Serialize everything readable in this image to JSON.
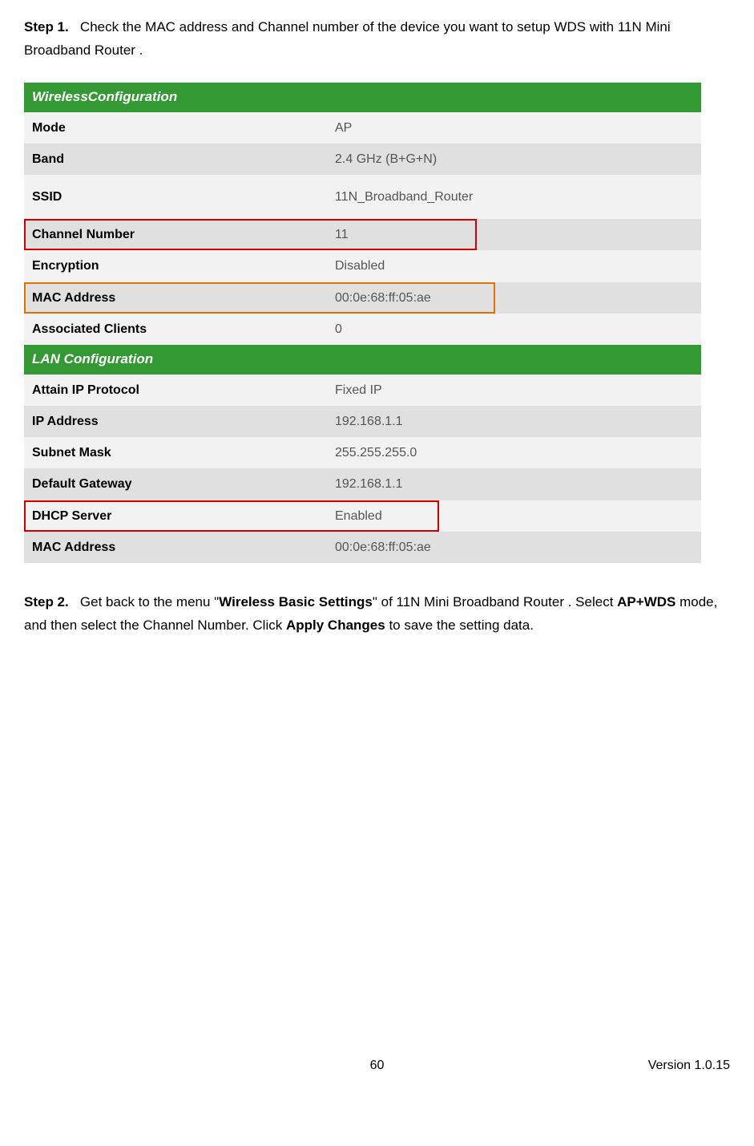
{
  "step1": {
    "label": "Step 1.",
    "text": "Check the MAC address and Channel number of the device you want to setup WDS with 11N Mini Broadband Router ."
  },
  "wireless": {
    "header": "WirelessConfiguration",
    "rows": {
      "mode": {
        "label": "Mode",
        "value": "AP"
      },
      "band": {
        "label": "Band",
        "value": "2.4 GHz (B+G+N)"
      },
      "ssid": {
        "label": "SSID",
        "value": "11N_Broadband_Router"
      },
      "channel": {
        "label": "Channel Number",
        "value": "11"
      },
      "encryption": {
        "label": "Encryption",
        "value": "Disabled"
      },
      "mac": {
        "label": "MAC Address",
        "value": "00:0e:68:ff:05:ae"
      },
      "clients": {
        "label": "Associated Clients",
        "value": "0"
      }
    }
  },
  "lan": {
    "header": "LAN Configuration",
    "rows": {
      "attain": {
        "label": "Attain IP Protocol",
        "value": "Fixed IP"
      },
      "ip": {
        "label": "IP Address",
        "value": "192.168.1.1"
      },
      "subnet": {
        "label": "Subnet Mask",
        "value": "255.255.255.0"
      },
      "gateway": {
        "label": "Default Gateway",
        "value": "192.168.1.1"
      },
      "dhcp": {
        "label": "DHCP Server",
        "value": "Enabled"
      },
      "mac": {
        "label": "MAC Address",
        "value": "00:0e:68:ff:05:ae"
      }
    }
  },
  "step2": {
    "label": "Step 2.",
    "pre": "Get back to the menu \"",
    "bold1": "Wireless Basic Settings",
    "mid1": "\" of 11N Mini Broadband Router . Select ",
    "bold2": "AP+WDS",
    "mid2": " mode, and then select the Channel Number. Click ",
    "bold3": "Apply Changes",
    "post": " to save the setting data."
  },
  "footer": {
    "page": "60",
    "version": "Version 1.0.15"
  }
}
